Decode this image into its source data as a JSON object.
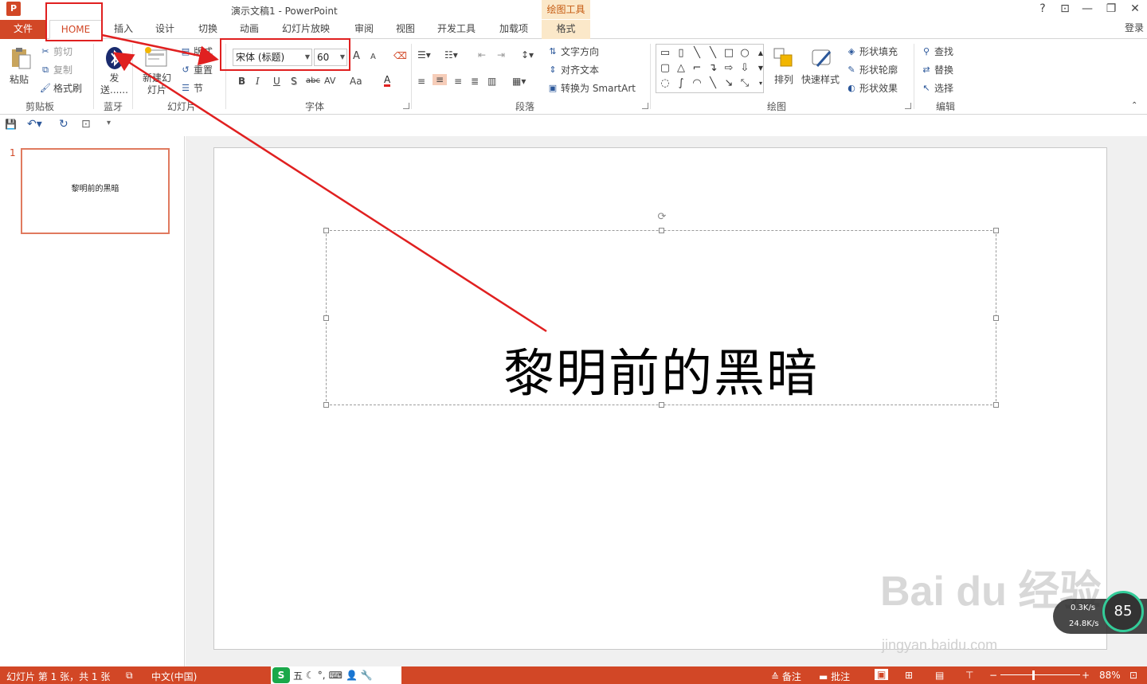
{
  "app": {
    "icon": "P",
    "title": "演示文稿1 - PowerPoint",
    "context_tool": "绘图工具",
    "signin": "登录"
  },
  "window": {
    "help": "?",
    "restore_ribbon": "⊡",
    "min": "—",
    "max": "❐",
    "close": "✕"
  },
  "tabs": [
    {
      "label": "文件"
    },
    {
      "label": "HOME"
    },
    {
      "label": "插入"
    },
    {
      "label": "设计"
    },
    {
      "label": "切换"
    },
    {
      "label": "动画"
    },
    {
      "label": "幻灯片放映"
    },
    {
      "label": "审阅"
    },
    {
      "label": "视图"
    },
    {
      "label": "开发工具"
    },
    {
      "label": "加载项"
    },
    {
      "label": "格式"
    }
  ],
  "ribbon": {
    "clipboard": {
      "paste": "粘贴",
      "cut": "剪切",
      "copy": "复制",
      "format_painter": "格式刷",
      "group": "剪贴板"
    },
    "bluetooth": {
      "send": "发送......",
      "group": "蓝牙"
    },
    "slides": {
      "new_slide": "新建幻灯片",
      "layout": "版式",
      "reset": "重置",
      "section": "节",
      "group": "幻灯片"
    },
    "font": {
      "font_name": "宋体 (标题)",
      "font_size": "60",
      "bold": "B",
      "italic": "I",
      "underline": "U",
      "shadow": "S",
      "strike": "abc",
      "spacing": "AV",
      "case": "Aa",
      "color": "A",
      "grow": "A",
      "shrink": "A",
      "group": "字体"
    },
    "paragraph": {
      "text_direction": "文字方向",
      "align_text": "对齐文本",
      "smartart": "转换为 SmartArt",
      "group": "段落"
    },
    "drawing": {
      "arrange": "排列",
      "quick_styles": "快速样式",
      "fill": "形状填充",
      "outline": "形状轮廓",
      "effects": "形状效果",
      "group": "绘图"
    },
    "editing": {
      "find": "查找",
      "replace": "替换",
      "select": "选择",
      "group": "编辑"
    }
  },
  "thumbnail": {
    "number": "1",
    "text": "黎明前的黑暗"
  },
  "slide": {
    "title": "黎明前的黑暗"
  },
  "status": {
    "slide_info": "幻灯片 第 1 张，共 1 张",
    "language": "中文(中国)",
    "ime": "五",
    "notes": "备注",
    "comments": "批注",
    "zoom": "88%"
  },
  "overlay": {
    "watermark": "Bai du 经验",
    "watermark_sub": "jingyan.baidu.com",
    "net_up": "0.3K/s",
    "net_down": "24.8K/s",
    "net_pct": "85"
  },
  "colors": {
    "accent": "#d24726",
    "context_tab_bg": "#fbe8c9",
    "annotation": "#e02020"
  }
}
